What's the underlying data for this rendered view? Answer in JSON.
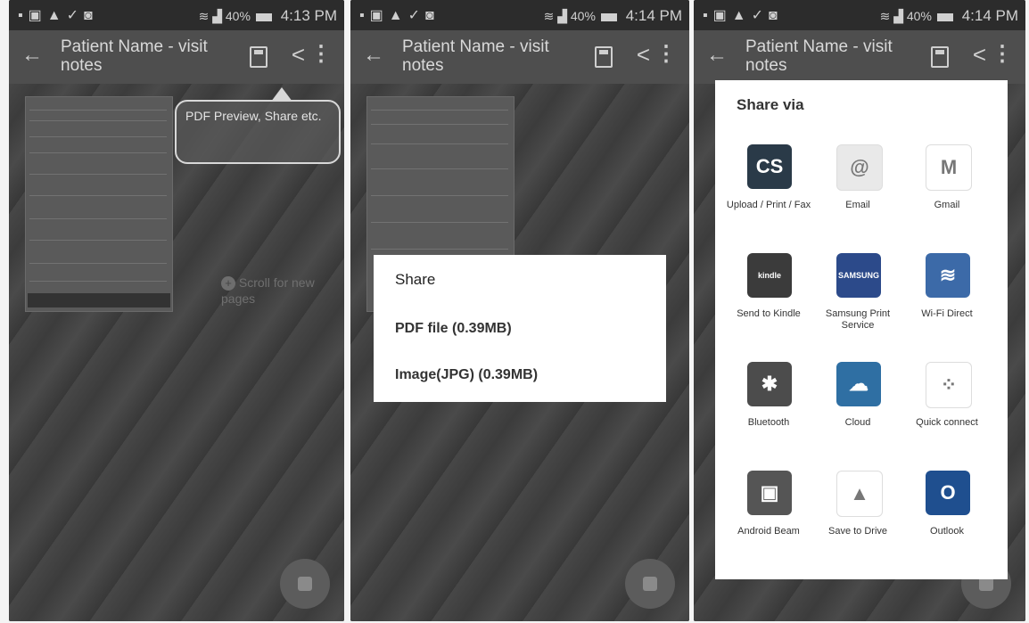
{
  "screens": [
    {
      "status": {
        "time": "4:13 PM",
        "battery": "40%"
      },
      "appbar": {
        "title": "Patient Name - visit notes"
      },
      "tooltip": "PDF Preview, Share etc.",
      "hint": "Scroll for new pages"
    },
    {
      "status": {
        "time": "4:14 PM",
        "battery": "40%"
      },
      "appbar": {
        "title": "Patient Name - visit notes"
      },
      "share_dialog": {
        "title": "Share",
        "options": [
          "PDF file (0.39MB)",
          "Image(JPG) (0.39MB)"
        ]
      }
    },
    {
      "status": {
        "time": "4:14 PM",
        "battery": "40%"
      },
      "appbar": {
        "title": "Patient Name - visit notes"
      },
      "via_dialog": {
        "title": "Share via",
        "items": [
          {
            "label": "Upload / Print / Fax",
            "icon": "camscanner-icon",
            "glyph": "CS",
            "color": "#2a3a48"
          },
          {
            "label": "Email",
            "icon": "email-icon",
            "glyph": "@",
            "color": "#e9e9e9"
          },
          {
            "label": "Gmail",
            "icon": "gmail-icon",
            "glyph": "M",
            "color": "#ffffff"
          },
          {
            "label": "Send to Kindle",
            "icon": "kindle-icon",
            "glyph": "kindle",
            "color": "#3b3b3b"
          },
          {
            "label": "Samsung Print Service",
            "icon": "samsung-print-icon",
            "glyph": "SAMSUNG",
            "color": "#2c4a8a"
          },
          {
            "label": "Wi-Fi Direct",
            "icon": "wifi-direct-icon",
            "glyph": "≋",
            "color": "#3c6aa8"
          },
          {
            "label": "Bluetooth",
            "icon": "bluetooth-icon",
            "glyph": "✱",
            "color": "#4c4c4c"
          },
          {
            "label": "Cloud",
            "icon": "cloud-icon",
            "glyph": "☁",
            "color": "#2f6fa3"
          },
          {
            "label": "Quick connect",
            "icon": "quick-connect-icon",
            "glyph": "⁘",
            "color": "#ffffff"
          },
          {
            "label": "Android Beam",
            "icon": "android-beam-icon",
            "glyph": "▣",
            "color": "#555555"
          },
          {
            "label": "Save to Drive",
            "icon": "drive-icon",
            "glyph": "▲",
            "color": "#ffffff"
          },
          {
            "label": "Outlook",
            "icon": "outlook-icon",
            "glyph": "O",
            "color": "#1f4f8f"
          }
        ]
      }
    }
  ]
}
